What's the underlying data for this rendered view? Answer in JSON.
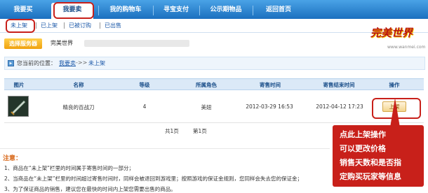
{
  "top_nav": {
    "tabs": [
      {
        "label": "我要买"
      },
      {
        "label": "我要卖"
      },
      {
        "label": "我的购物车"
      },
      {
        "label": "寻宝支付"
      },
      {
        "label": "公示期物品"
      },
      {
        "label": "返回首页"
      }
    ],
    "active_index": 1
  },
  "sub_nav": {
    "items": [
      {
        "label": "未上架"
      },
      {
        "label": "已上架"
      },
      {
        "label": "已被订购"
      },
      {
        "label": "已出售"
      }
    ],
    "active_index": 0
  },
  "server": {
    "button_label": "选择服务器",
    "name": "完美世界"
  },
  "logo": {
    "text": "完美世界",
    "sub": "www.wanmei.com"
  },
  "breadcrumb": {
    "label": "您当前的位置：",
    "link": "我要卖",
    "arrow": "->>",
    "current": "未上架"
  },
  "table": {
    "headers": [
      "图片",
      "名称",
      "等级",
      "所属角色",
      "寄售时间",
      "寄售结束时间",
      "操作"
    ],
    "rows": [
      {
        "name": "精良的百战刀",
        "level": "4",
        "role": "美妞",
        "start": "2012-03-29 16:53",
        "end": "2012-04-12 17:23",
        "action": "上架"
      }
    ]
  },
  "pager": {
    "total": "共1页",
    "page": "第1页"
  },
  "notes": {
    "title": "注意：",
    "items": [
      "1、商品在“未上架”栏里的时间属于寄售时间的一部分；",
      "2、当商品在“未上架”栏里的时间超过寄售时间时，同样会被退回到游戏里；按照游戏的保证金规则，您同样会失去您的保证金；",
      "3、为了保证商品的销售，建议您在最快的时间内上架您需要出售的商品。"
    ]
  },
  "annotation": {
    "lines": [
      "点此上架操作",
      "可以更改价格",
      "销售天数和是否指",
      "定购买玩家等信息"
    ]
  },
  "colors": {
    "nav_blue": "#1b6fbf",
    "highlight_red": "#c8201a",
    "link_blue": "#1b58a8",
    "server_orange": "#f0a10f"
  }
}
